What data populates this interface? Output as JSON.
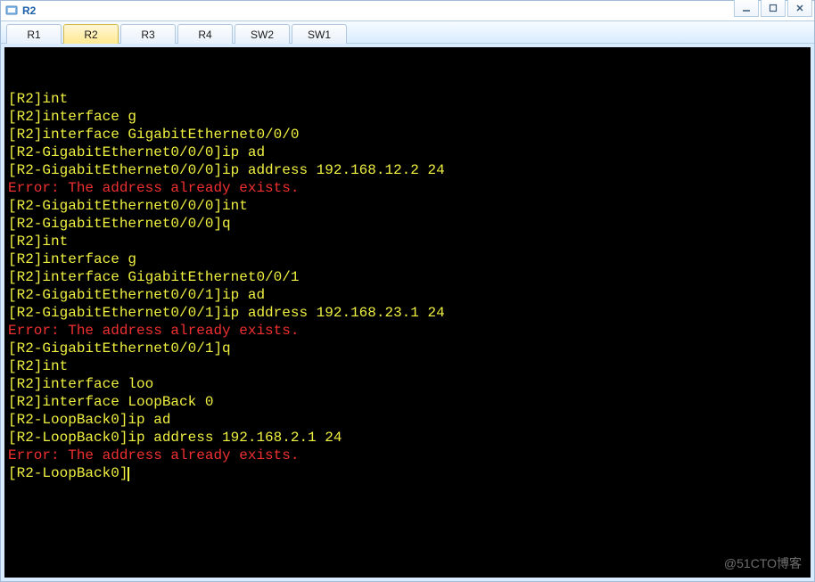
{
  "title": "R2",
  "tabs": [
    {
      "label": "R1",
      "active": false
    },
    {
      "label": "R2",
      "active": true
    },
    {
      "label": "R3",
      "active": false
    },
    {
      "label": "R4",
      "active": false
    },
    {
      "label": "SW2",
      "active": false
    },
    {
      "label": "SW1",
      "active": false
    }
  ],
  "terminal_lines": [
    {
      "text": "[R2]int",
      "c": "y"
    },
    {
      "text": "[R2]interface g",
      "c": "y"
    },
    {
      "text": "[R2]interface GigabitEthernet0/0/0",
      "c": "y"
    },
    {
      "text": "[R2-GigabitEthernet0/0/0]ip ad",
      "c": "y"
    },
    {
      "text": "[R2-GigabitEthernet0/0/0]ip address 192.168.12.2 24",
      "c": "y"
    },
    {
      "text": "Error: The address already exists.",
      "c": "r"
    },
    {
      "text": "[R2-GigabitEthernet0/0/0]int",
      "c": "y"
    },
    {
      "text": "[R2-GigabitEthernet0/0/0]q",
      "c": "y"
    },
    {
      "text": "[R2]int",
      "c": "y"
    },
    {
      "text": "[R2]interface g",
      "c": "y"
    },
    {
      "text": "[R2]interface GigabitEthernet0/0/1",
      "c": "y"
    },
    {
      "text": "[R2-GigabitEthernet0/0/1]ip ad",
      "c": "y"
    },
    {
      "text": "[R2-GigabitEthernet0/0/1]ip address 192.168.23.1 24",
      "c": "y"
    },
    {
      "text": "Error: The address already exists.",
      "c": "r"
    },
    {
      "text": "[R2-GigabitEthernet0/0/1]q",
      "c": "y"
    },
    {
      "text": "[R2]int",
      "c": "y"
    },
    {
      "text": "[R2]interface loo",
      "c": "y"
    },
    {
      "text": "[R2]interface LoopBack 0",
      "c": "y"
    },
    {
      "text": "[R2-LoopBack0]ip ad",
      "c": "y"
    },
    {
      "text": "[R2-LoopBack0]ip address 192.168.2.1 24",
      "c": "y"
    },
    {
      "text": "Error: The address already exists.",
      "c": "r"
    },
    {
      "text": "[R2-LoopBack0]",
      "c": "y",
      "cursor": true
    }
  ],
  "watermark": "@51CTO博客"
}
